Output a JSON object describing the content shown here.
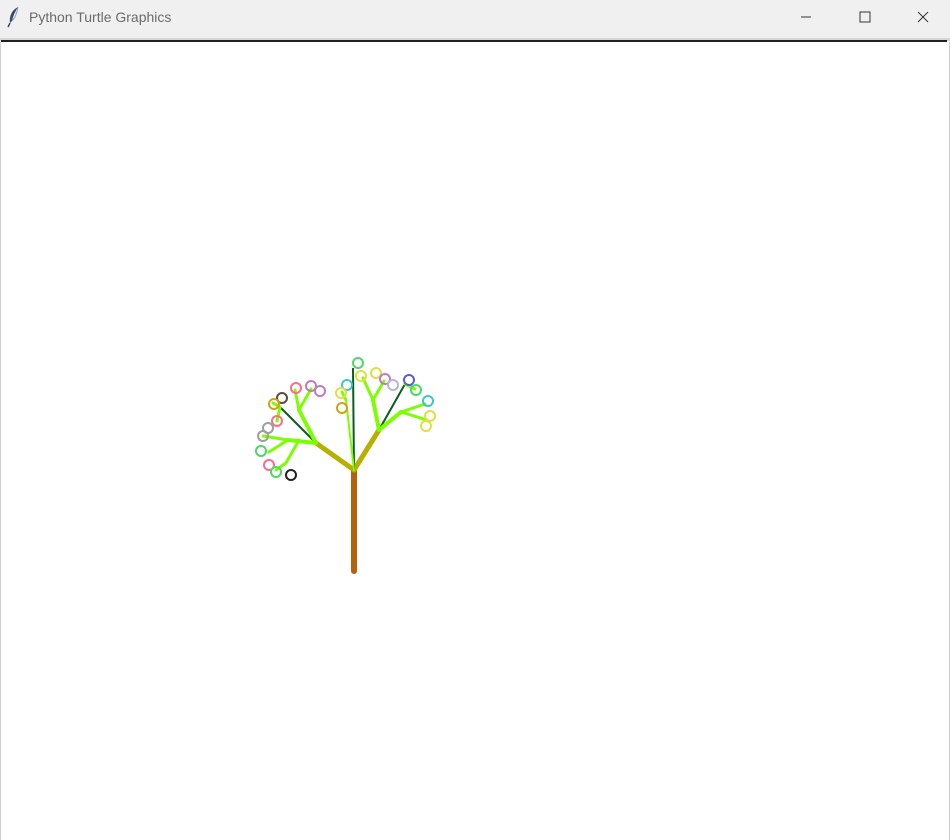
{
  "window": {
    "title": "Python Turtle Graphics",
    "app_icon": "feather-icon",
    "controls": {
      "minimize_icon": "minimize-icon",
      "maximize_icon": "maximize-icon",
      "close_icon": "close-icon"
    }
  },
  "canvas": {
    "background": "#ffffff",
    "drawing": "fractal-tree",
    "colors": {
      "trunk": "#b5620f",
      "branch": "#b6b000",
      "twig": "#7cff00",
      "stem": "#0b5d1e",
      "blossoms": [
        "#4cd964",
        "#9e9e9e",
        "#ff6b8b",
        "#c07ac0",
        "#d4a017",
        "#3ec6c6",
        "#5a5ae0",
        "#e0e040",
        "#222222",
        "#5c4a3a",
        "#b5b5e0"
      ]
    }
  }
}
